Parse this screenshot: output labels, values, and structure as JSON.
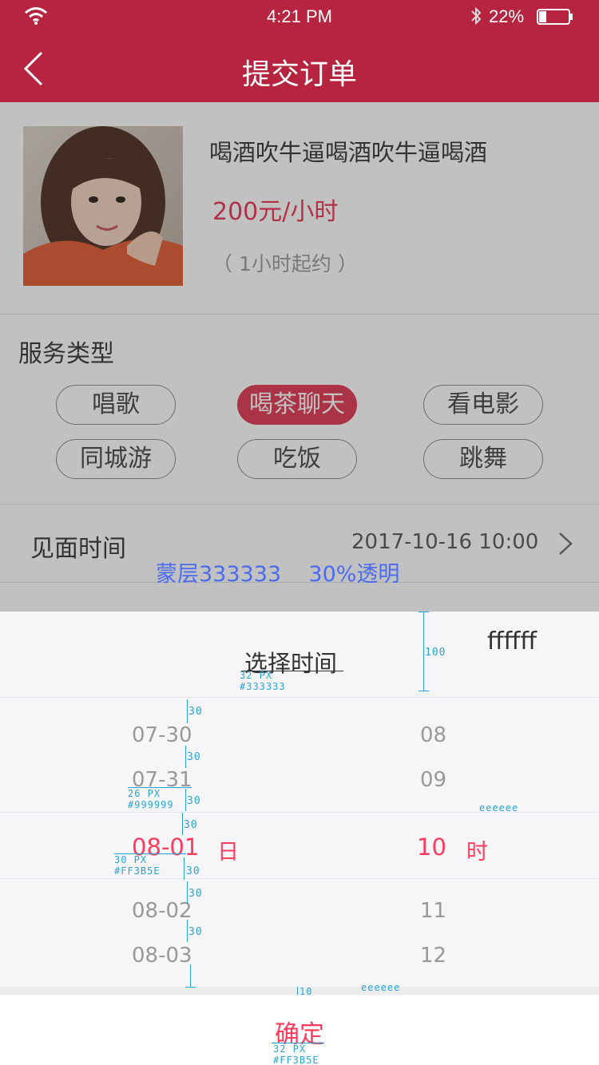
{
  "status_bar": {
    "time": "4:21 PM",
    "battery_percent": "22%"
  },
  "nav": {
    "title": "提交订单",
    "back_icon": "chevron-left-icon"
  },
  "product": {
    "name": "喝酒吹牛逼喝酒吹牛逼喝酒",
    "price": "200元/小时",
    "min_order": "（ 1小时起约 ）"
  },
  "service_type": {
    "label": "服务类型",
    "options": [
      "唱歌",
      "喝茶聊天",
      "看电影",
      "同城游",
      "吃饭",
      "跳舞"
    ],
    "selected": "喝茶聊天"
  },
  "meet_time": {
    "label": "见面时间",
    "value": "2017-10-16  10:00"
  },
  "overlay_note": "蒙层333333    30%透明",
  "picker": {
    "title": "选择时间",
    "bg_note": "ffffff",
    "dates": [
      "07-30",
      "07-31",
      "08-01",
      "08-02",
      "08-03"
    ],
    "hours": [
      "08",
      "09",
      "10",
      "11",
      "12"
    ],
    "selected_index": 2,
    "day_unit": "日",
    "hour_unit": "时",
    "confirm_label": "确定"
  },
  "annotations": {
    "header_height": "100",
    "title_spec": [
      "32 PX",
      "#333333"
    ],
    "item_spec": [
      "26 PX",
      "#999999"
    ],
    "sel_spec": [
      "30 PX",
      "#FF3B5E"
    ],
    "confirm_spec": [
      "32 PX",
      "#FF3B5E"
    ],
    "divider_color": "eeeeee",
    "gap_color": "eeeeee",
    "gap_height": "10",
    "spacing": [
      "30",
      "30",
      "30",
      "30",
      "30",
      "30",
      "30"
    ]
  },
  "colors": {
    "brand": "#b7243f",
    "accent": "#ff3b5e",
    "chip_active": "#e0344f",
    "annotation": "#2aa5d6"
  }
}
